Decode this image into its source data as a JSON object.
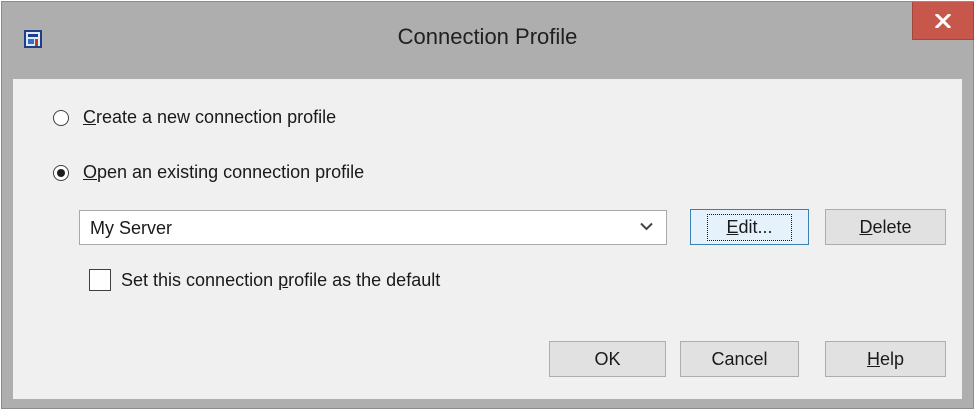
{
  "window": {
    "title": "Connection Profile",
    "close_glyph": "x",
    "app_icon": "connection-profile-app-icon"
  },
  "options": {
    "create_new": {
      "prefix": "C",
      "rest": "reate a new connection profile",
      "selected": false
    },
    "open_existing": {
      "prefix": "O",
      "rest": "pen an existing connection profile",
      "selected": true
    }
  },
  "profile_select": {
    "value": "My Server",
    "arrow_icon": "chevron-down-icon"
  },
  "buttons": {
    "edit": {
      "prefix": "E",
      "rest": "dit..."
    },
    "delete": {
      "prefix": "D",
      "rest": "elete"
    },
    "ok": "OK",
    "cancel": "Cancel",
    "help": {
      "prefix": "H",
      "rest": "elp"
    }
  },
  "default_checkbox": {
    "before": "Set this connection ",
    "accel": "p",
    "after": "rofile as the default",
    "checked": false
  },
  "colors": {
    "titlebar": "#aeaeae",
    "close_button": "#c7574a",
    "dialog_background": "#f0f0f0",
    "focus_border": "#3c7fb1"
  }
}
